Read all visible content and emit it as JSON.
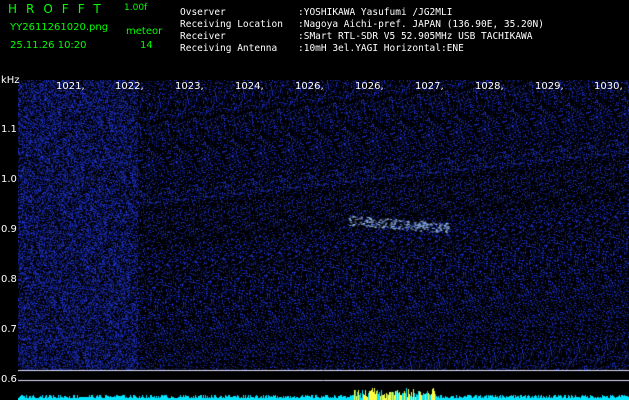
{
  "header": {
    "title": "HROFFT",
    "version": "1.00f",
    "filename": "YY2611261020.png",
    "meteor_label": "meteor",
    "datetime": "25.11.26 10:20",
    "meteor_count": "14"
  },
  "info": [
    {
      "label": "Ovserver",
      "value": ":YOSHIKAWA Yasufumi /JG2MLI"
    },
    {
      "label": "Receiving Location",
      "value": ":Nagoya Aichi-pref. JAPAN (136.90E, 35.20N)"
    },
    {
      "label": "Receiver",
      "value": ":SMart RTL-SDR V5 52.905MHz USB TACHIKAWA"
    },
    {
      "label": "Receiving Antenna",
      "value": ":10mH 3el.YAGI Horizontal:ENE"
    }
  ],
  "axis": {
    "unit": "kHz",
    "freq_labels": [
      "1021,",
      "1022,",
      "1023,",
      "1024,",
      "1026,",
      "1026,",
      "1027,",
      "1028,",
      "1029,",
      "1030,"
    ],
    "y_labels": [
      "1.1",
      "1.0",
      "0.9",
      "0.8",
      "0.7",
      "0.6"
    ]
  },
  "colors": {
    "background": "#000000",
    "noise": "#1a2fd0",
    "echo": "#a0c8ff",
    "header_text": "#00ff00",
    "info_text": "#ffffff",
    "level_bar": "#00e5ff",
    "level_peak": "#ffff40"
  }
}
